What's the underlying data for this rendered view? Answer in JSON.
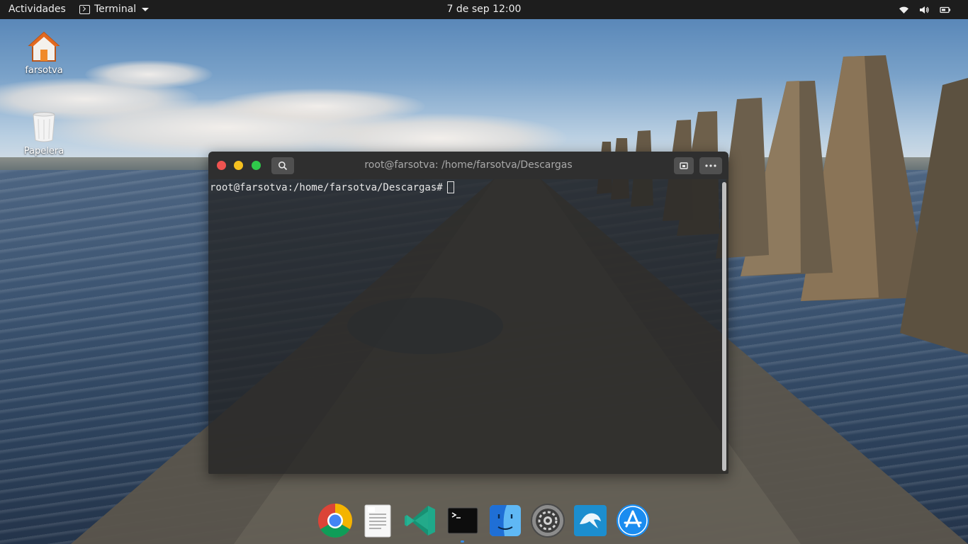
{
  "topbar": {
    "activities": "Actividades",
    "app_menu_label": "Terminal",
    "clock": "7 de sep  12:00",
    "tray_icons": [
      "wifi-icon",
      "volume-icon",
      "battery-icon"
    ]
  },
  "desktop": {
    "icons": [
      {
        "label": "farsotva",
        "icon": "home-folder-icon"
      },
      {
        "label": "Papelera",
        "icon": "trash-icon"
      }
    ]
  },
  "terminal": {
    "title": "root@farsotva: /home/farsotva/Descargas",
    "prompt": "root@farsotva:/home/farsotva/Descargas#",
    "buttons": [
      "search-icon",
      "new-tab-icon",
      "menu-icon"
    ],
    "colors": {
      "close": "#ef5350",
      "minimize": "#f5c01f",
      "maximize": "#2fc94a"
    }
  },
  "dock": {
    "apps": [
      {
        "name": "chrome-icon"
      },
      {
        "name": "text-editor-icon"
      },
      {
        "name": "vscode-icon"
      },
      {
        "name": "terminal-icon"
      },
      {
        "name": "finder-icon"
      },
      {
        "name": "settings-icon"
      },
      {
        "name": "mysql-workbench-icon"
      },
      {
        "name": "app-store-icon"
      }
    ]
  }
}
